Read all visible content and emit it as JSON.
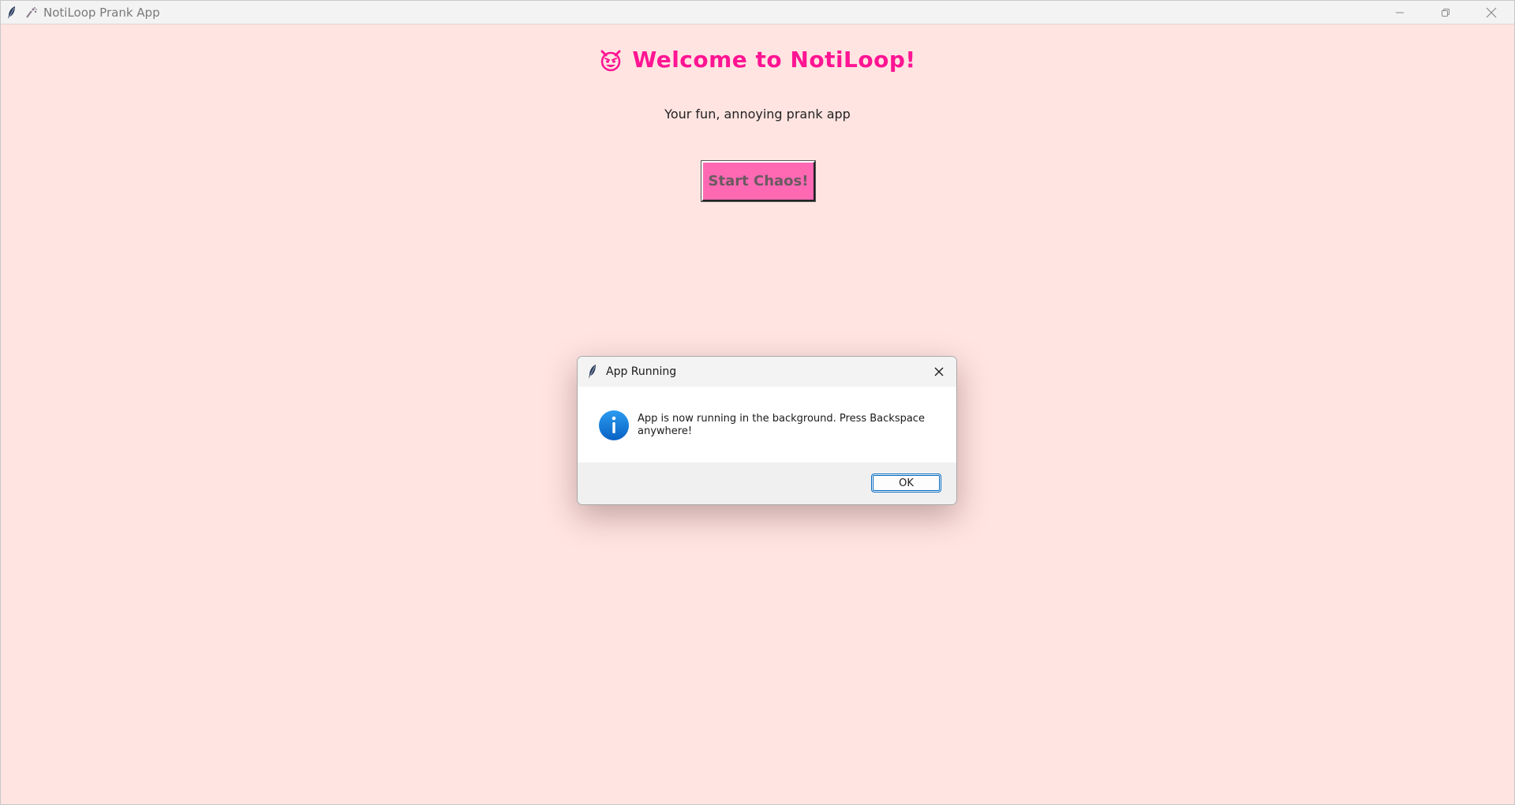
{
  "window": {
    "title": "NotiLoop Prank App",
    "app_icon": "feather-icon",
    "title_icon": "sparkle-icon",
    "background": "#ffe4e1"
  },
  "main": {
    "heading_emoji": "😈",
    "heading": "Welcome to NotiLoop!",
    "subtitle": "Your fun, annoying prank app",
    "start_button_label": "Start Chaos!",
    "accent": "#ff1493",
    "button_color": "#ff69b4"
  },
  "dialog": {
    "title": "App Running",
    "icon": "info-icon",
    "message": "App is now running in the background. Press Backspace anywhere!",
    "ok_label": "OK"
  }
}
